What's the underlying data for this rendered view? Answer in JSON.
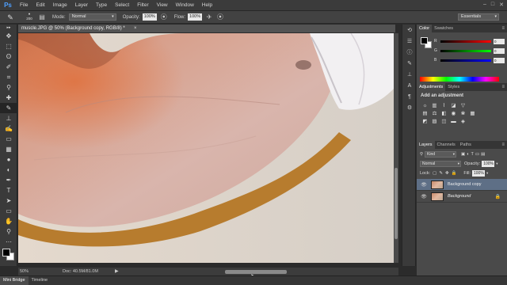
{
  "menu": {
    "logo": "Ps",
    "items": [
      "File",
      "Edit",
      "Image",
      "Layer",
      "Type",
      "Select",
      "Filter",
      "View",
      "Window",
      "Help"
    ],
    "window_controls": [
      "–",
      "□",
      "✕"
    ]
  },
  "options": {
    "brush_size": "200",
    "mode_label": "Mode:",
    "mode_value": "Normal",
    "opacity_label": "Opacity:",
    "opacity_value": "100%",
    "flow_label": "Flow:",
    "flow_value": "100%",
    "workspace": "Essentials"
  },
  "document": {
    "tab_title": "muscle.JPG @ 50% (Background copy, RGB/8) *",
    "close": "×",
    "zoom": "50%",
    "doc_info": "Doc: 40.5M/81.0M"
  },
  "bottom_tabs": [
    "Mini Bridge",
    "Timeline"
  ],
  "color_panel": {
    "tabs": [
      "Color",
      "Swatches"
    ],
    "rows": [
      {
        "label": "R",
        "value": "0",
        "gradient": "linear-gradient(90deg,#000,#f00)"
      },
      {
        "label": "G",
        "value": "0",
        "gradient": "linear-gradient(90deg,#000,#0f0)"
      },
      {
        "label": "B",
        "value": "0",
        "gradient": "linear-gradient(90deg,#000,#00f)"
      }
    ]
  },
  "adjustments_panel": {
    "tabs": [
      "Adjustments",
      "Styles"
    ],
    "title": "Add an adjustment"
  },
  "layers_panel": {
    "tabs": [
      "Layers",
      "Channels",
      "Paths"
    ],
    "kind_label": "Kind",
    "blend_mode": "Normal",
    "opacity_label": "Opacity:",
    "opacity_value": "100%",
    "lock_label": "Lock:",
    "fill_label": "Fill:",
    "fill_value": "100%",
    "layers": [
      {
        "name": "Background copy",
        "selected": true
      },
      {
        "name": "Background",
        "selected": false
      }
    ]
  },
  "colors": {
    "selection": "#5e6f86",
    "shadow": "#b77c2e"
  }
}
